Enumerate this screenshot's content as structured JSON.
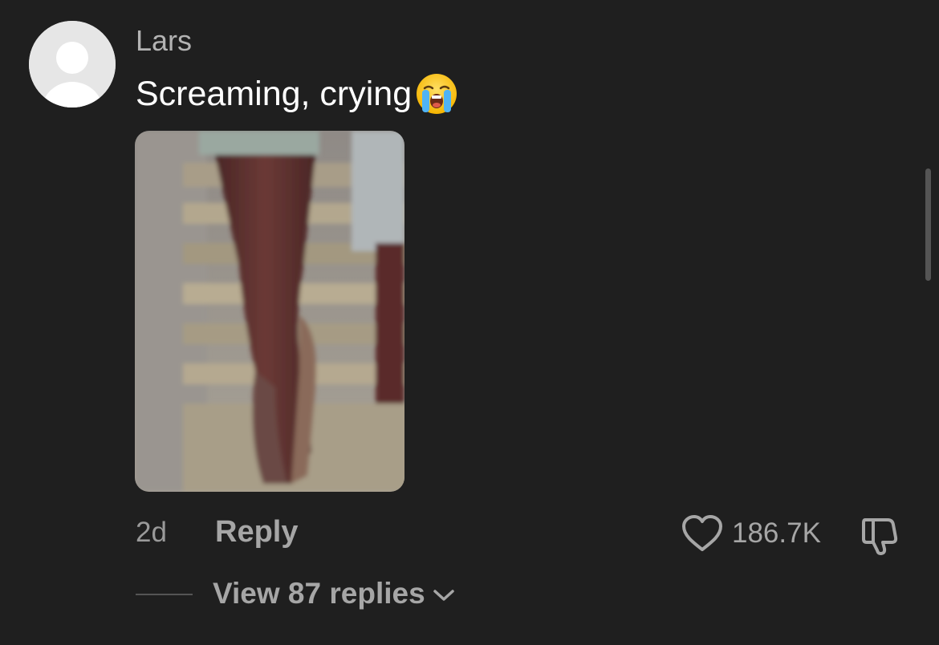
{
  "comment": {
    "username": "Lars",
    "text": "Screaming, crying",
    "emoji": "loudly-crying-face-emoji",
    "attachment": "photo-of-legs-walking-on-stairs",
    "timestamp": "2d",
    "reply_label": "Reply",
    "like_count": "186.7K",
    "view_replies_label": "View 87 replies"
  },
  "icons": {
    "avatar": "default-user-avatar-icon",
    "like": "heart-icon",
    "dislike": "thumbs-down-icon",
    "expand": "chevron-down-icon"
  },
  "colors": {
    "background": "#1f1f1f",
    "primary_text": "#ffffff",
    "secondary_text": "#a6a6a6",
    "avatar_bg": "#e6e6e6"
  }
}
